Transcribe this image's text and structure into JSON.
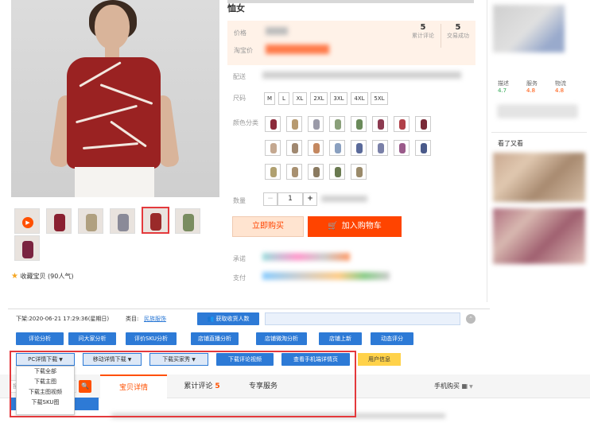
{
  "product": {
    "title_line2": "恤女"
  },
  "price": {
    "price_label": "价格",
    "taobao_label": "淘宝价",
    "stats": [
      {
        "value": "5",
        "label": "累计评论"
      },
      {
        "value": "5",
        "label": "交易成功"
      }
    ]
  },
  "options": {
    "delivery_label": "配送",
    "size_label": "尺码",
    "sizes": [
      "M",
      "L",
      "XL",
      "2XL",
      "3XL",
      "4XL",
      "5XL"
    ],
    "color_label": "颜色分类",
    "quantity_label": "数量",
    "quantity_value": "1",
    "minus": "−",
    "plus": "+"
  },
  "actions": {
    "buy_now": "立即购买",
    "add_to_cart": "加入购物车",
    "cart_icon": "cart-icon"
  },
  "service": {
    "promise_label": "承诺",
    "payment_label": "支付"
  },
  "gallery": {
    "favorite": "收藏宝贝 (90人气)",
    "favorite_icon": "star-icon"
  },
  "shop": {
    "ratings": [
      {
        "label": "描述",
        "value": "4.7",
        "color": "#31a854"
      },
      {
        "label": "服务",
        "value": "4.8",
        "color": "#ff5000"
      },
      {
        "label": "物流",
        "value": "4.8",
        "color": "#ff5000"
      }
    ],
    "seen_also": "看了又看"
  },
  "toolbar": {
    "listed_text": "下架:2020-06-21 17:29:36(星期日)",
    "category_label": "类目:",
    "category_value": "民族服饰",
    "get_buyers": "获取收货人数",
    "row1": [
      "评论分析",
      "问大家分析",
      "评价SKU分析",
      "店铺直播分析",
      "店铺微淘分析",
      "店铺上新",
      "动态评分"
    ],
    "pc_detail": "PC详情下载",
    "mobile_detail": "移动详情下载",
    "buyer_show": "下载买家秀",
    "review_video": "下载评论视频",
    "mobile_detail_view": "查看手机端详情页",
    "user_info": "用户信息"
  },
  "dropdown": {
    "items": [
      "下载全部",
      "下载主图",
      "下载主图视频",
      "下载SKU图"
    ]
  },
  "tabs": {
    "search_placeholder": "搜",
    "items": [
      {
        "label": "宝贝详情"
      },
      {
        "label": "累计评论",
        "count": "5"
      },
      {
        "label": "专享服务"
      }
    ],
    "mobile_buy": "手机购买"
  },
  "colors": {
    "accent": "#ff5000",
    "tool_blue": "#2d7ad6",
    "frame_red": "#e4393c"
  }
}
